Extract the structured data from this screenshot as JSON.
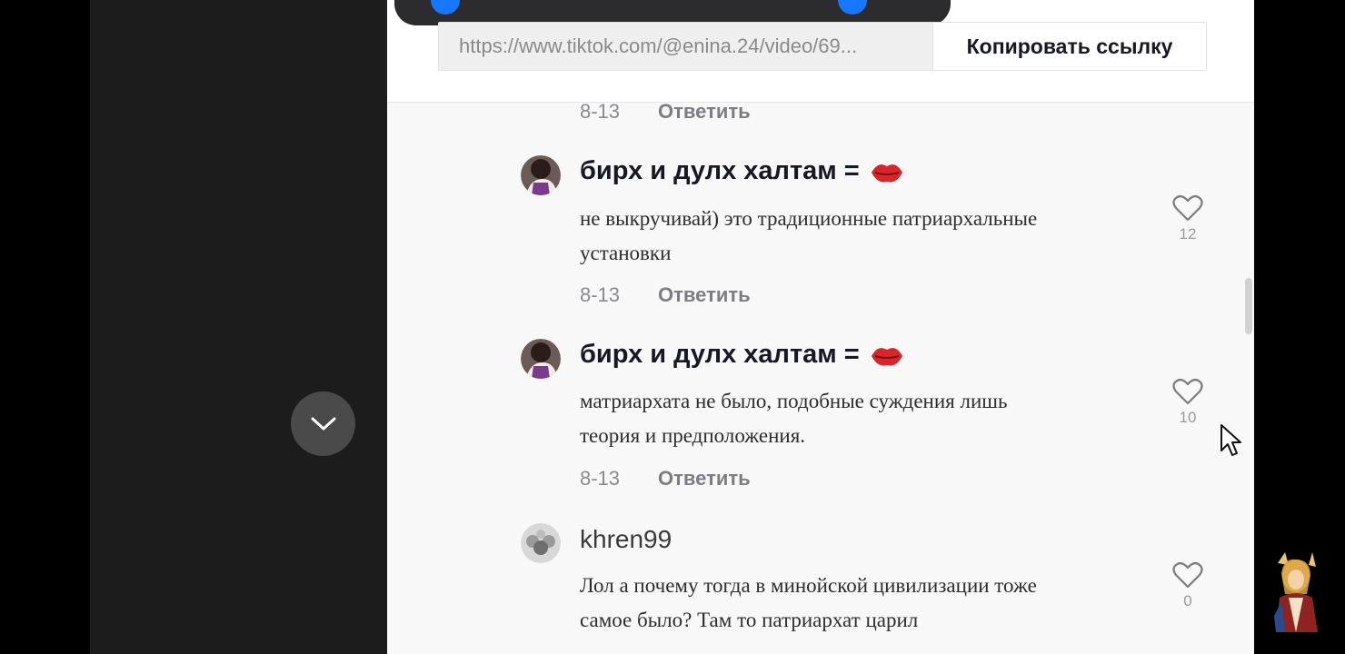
{
  "share": {
    "url_text": "https://www.tiktok.com/@enina.24/video/69...",
    "copy_label": "Копировать ссылку"
  },
  "comments": [
    {
      "date": "8-13",
      "reply_label": "Ответить"
    },
    {
      "username": "бирх и дулх халтам =",
      "text_line1": "не выкручивай) это традиционные патриархальные",
      "text_line2": "установки",
      "likes": "12",
      "date": "8-13",
      "reply_label": "Ответить"
    },
    {
      "username": "бирх и дулх халтам =",
      "text_line1": "матриархата не было, подобные суждения лишь",
      "text_line2": "теория и предположения.",
      "likes": "10",
      "date": "8-13",
      "reply_label": "Ответить"
    },
    {
      "username": "khren99",
      "text_line1": "Лол а почему тогда в минойской цивилизации тоже",
      "text_line2": "самое было? Там то патриархат царил",
      "likes": "0"
    }
  ],
  "icons": {
    "collapse": "chevron-down-icon",
    "like": "heart-outline-icon",
    "emoji": "red-lips-emoji",
    "cursor": "mouse-pointer-icon"
  },
  "colors": {
    "accent": "#1677ff",
    "emoji_red": "#d7262a"
  }
}
